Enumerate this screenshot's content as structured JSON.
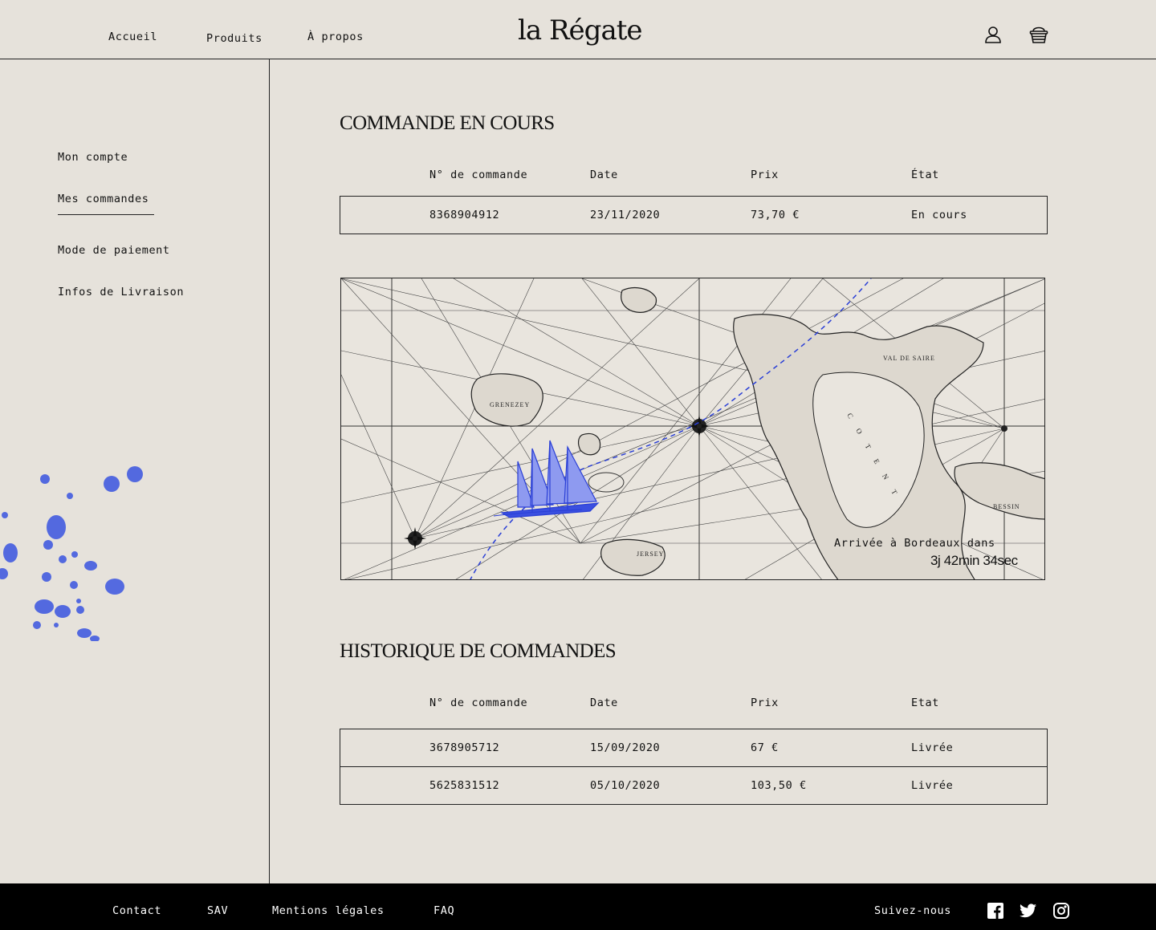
{
  "header": {
    "nav": [
      "Accueil",
      "Produits",
      "À propos"
    ],
    "logo": "la Régate",
    "icons": [
      "user-icon",
      "basket-icon"
    ]
  },
  "sidebar": {
    "items": [
      "Mon compte",
      "Mes commandes",
      "Mode de paiement",
      "Infos de Livraison"
    ],
    "active_item": "Mes commandes"
  },
  "current_order": {
    "title": "COMMANDE EN COURS",
    "columns": [
      "N° de commande",
      "Date",
      "Prix",
      "État"
    ],
    "row": [
      "8368904912",
      "23/11/2020",
      "73,70 €",
      "En cours"
    ]
  },
  "map": {
    "arrival_label": "Arrivée à Bordeaux dans",
    "countdown": "3j 42min 34sec",
    "place_labels": [
      "GRENEZEY",
      "JERSEY",
      "VAL DE SAIRE",
      "COTENT",
      "BESSIN"
    ],
    "accent_color": "#2a3fd6"
  },
  "history": {
    "title": "HISTORIQUE DE COMMANDES",
    "columns": [
      "N° de commande",
      "Date",
      "Prix",
      "Etat"
    ],
    "rows": [
      [
        "3678905712",
        "15/09/2020",
        "67 €",
        "Livrée"
      ],
      [
        "5625831512",
        "05/10/2020",
        "103,50 €",
        "Livrée"
      ]
    ]
  },
  "footer": {
    "links": [
      "Contact",
      "SAV",
      "Mentions légales",
      "FAQ"
    ],
    "follow_label": "Suivez-nous",
    "social_icons": [
      "facebook-icon",
      "twitter-icon",
      "instagram-icon"
    ]
  }
}
